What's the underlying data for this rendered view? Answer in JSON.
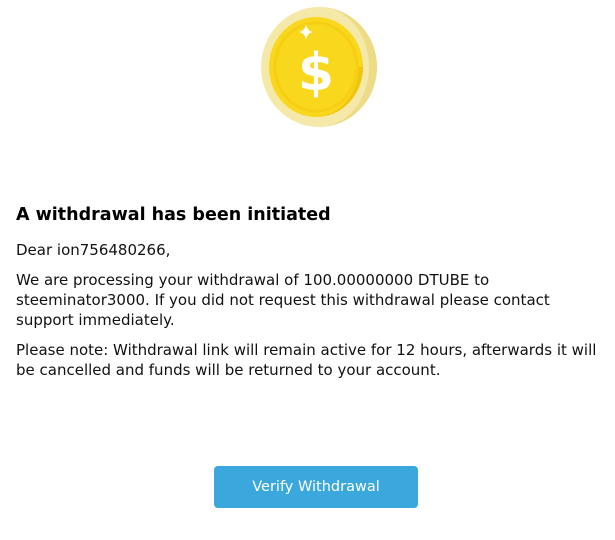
{
  "email": {
    "heading": "A withdrawal has been initiated",
    "greeting": "Dear ion756480266,",
    "body_processing": "We are processing your withdrawal of 100.00000000 DTUBE to steeminator3000. If you did not request this withdrawal please contact support immediately.",
    "body_note": "Please note: Withdrawal link will remain active for 12 hours, afterwards it will be cancelled and funds will be returned to your account.",
    "verify_button_label": "Verify Withdrawal"
  },
  "icons": {
    "hero": "dollar-coin-icon"
  },
  "colors": {
    "button": "#3aa8dd",
    "coin_face": "#f9d71c",
    "coin_rim": "#f4e9a8",
    "coin_shadow": "#f1c40f"
  }
}
